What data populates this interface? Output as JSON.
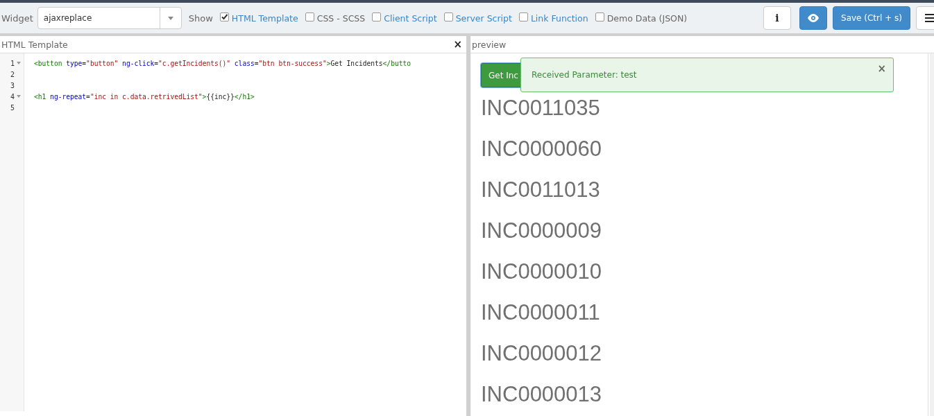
{
  "toolbar": {
    "widget_label": "Widget",
    "widget_value": "ajaxreplace",
    "show_label": "Show",
    "options": [
      {
        "label": "HTML Template",
        "checked": true,
        "kind": "link"
      },
      {
        "label": "CSS - SCSS",
        "checked": false,
        "kind": "plain"
      },
      {
        "label": "Client Script",
        "checked": false,
        "kind": "link"
      },
      {
        "label": "Server Script",
        "checked": false,
        "kind": "link"
      },
      {
        "label": "Link Function",
        "checked": false,
        "kind": "link"
      },
      {
        "label": "Demo Data (JSON)",
        "checked": false,
        "kind": "plain"
      }
    ],
    "info_button": "i",
    "save_button": "Save (Ctrl + s)"
  },
  "editor": {
    "title": "HTML Template",
    "close": "×",
    "lines": [
      {
        "number": "1",
        "fold": true,
        "tokens": [
          {
            "kind": "tag",
            "text": "<button"
          },
          {
            "kind": "attr",
            "text": " type"
          },
          {
            "kind": "text",
            "text": "="
          },
          {
            "kind": "str",
            "text": "\"button\""
          },
          {
            "kind": "attr",
            "text": " ng-click"
          },
          {
            "kind": "text",
            "text": "="
          },
          {
            "kind": "str",
            "text": "\"c.getIncidents()\""
          },
          {
            "kind": "attr",
            "text": " class"
          },
          {
            "kind": "text",
            "text": "="
          },
          {
            "kind": "str",
            "text": "\"btn btn-success\""
          },
          {
            "kind": "tag",
            "text": ">"
          },
          {
            "kind": "text",
            "text": "Get Incidents"
          },
          {
            "kind": "tag",
            "text": "</butto"
          }
        ]
      },
      {
        "number": "2",
        "fold": false
      },
      {
        "number": "3",
        "fold": false
      },
      {
        "number": "4",
        "fold": true,
        "tokens": [
          {
            "kind": "tag",
            "text": "<h1"
          },
          {
            "kind": "attr",
            "text": " ng-repeat"
          },
          {
            "kind": "text",
            "text": "="
          },
          {
            "kind": "str",
            "text": "\"inc in c.data.retrivedList\""
          },
          {
            "kind": "tag",
            "text": ">"
          },
          {
            "kind": "text",
            "text": "{{inc}}"
          },
          {
            "kind": "tag",
            "text": "</h1>"
          }
        ]
      },
      {
        "number": "5",
        "fold": false
      }
    ]
  },
  "preview": {
    "title": "preview",
    "button": "Get Inc",
    "alert": {
      "message": "Received Parameter: test",
      "close": "×"
    },
    "incidents": [
      "INC0011035",
      "INC0000060",
      "INC0011013",
      "INC0000009",
      "INC0000010",
      "INC0000011",
      "INC0000012",
      "INC0000013"
    ]
  }
}
